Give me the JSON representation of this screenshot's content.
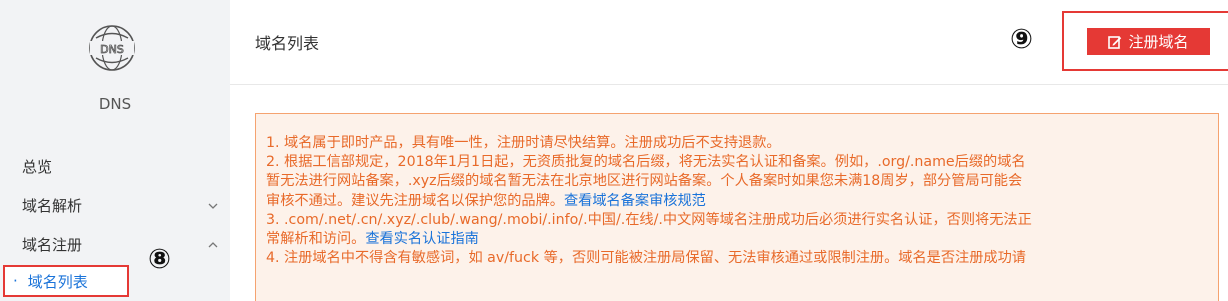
{
  "sidebar": {
    "brand": "DNS",
    "logo_text": "DNS",
    "items": [
      {
        "label": "总览"
      },
      {
        "label": "域名解析"
      },
      {
        "label": "域名注册"
      }
    ],
    "sub_items": [
      {
        "bullet": "·",
        "label": "域名列表"
      }
    ]
  },
  "callouts": {
    "eight": "⑧",
    "nine": "⑨"
  },
  "header": {
    "title": "域名列表",
    "register_button": "注册域名"
  },
  "notice": {
    "line1": "1. 域名属于即时产品，具有唯一性，注册时请尽快结算。注册成功后不支持退款。",
    "line2": "2. 根据工信部规定，2018年1月1日起，无资质批复的域名后缀，将无法实名认证和备案。例如，.org/.name后缀的域名",
    "line3": "暂无法进行网站备案，.xyz后缀的域名暂无法在北京地区进行网站备案。个人备案时如果您未满18周岁，部分管局可能会",
    "line4_text": "审核不通过。建议先注册域名以保护您的品牌。",
    "line4_link": "查看域名备案审核规范",
    "line5": "3. .com/.net/.cn/.xyz/.club/.wang/.mobi/.info/.中国/.在线/.中文网等域名注册成功后必须进行实名认证，否则将无法正",
    "line6_text": "常解析和访问。",
    "line6_link": "查看实名认证指南",
    "line7": "4. 注册域名中不得含有敏感词，如 av/fuck 等，否则可能被注册局保留、无法审核通过或限制注册。域名是否注册成功请"
  },
  "colors": {
    "accent": "#e53935",
    "notice_text": "#e86a2a",
    "link": "#1a73d9"
  },
  "icons": {
    "logo": "dns-globe-icon",
    "register": "edit-icon",
    "chevron_down": "chevron-down-icon",
    "chevron_up": "chevron-up-icon"
  }
}
